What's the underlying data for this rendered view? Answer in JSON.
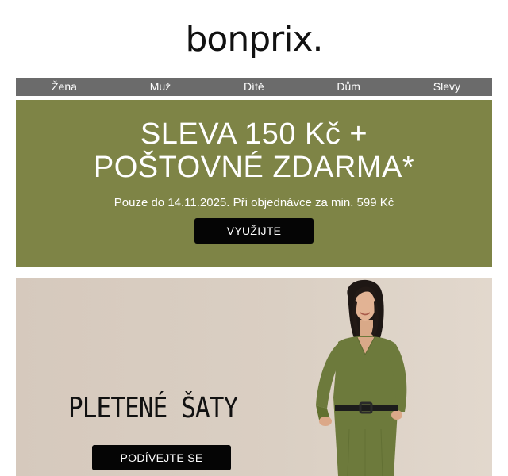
{
  "brand": {
    "logo_text": "bonprix."
  },
  "nav": {
    "items": [
      {
        "label": "Žena"
      },
      {
        "label": "Muž"
      },
      {
        "label": "Dítě"
      },
      {
        "label": "Dům"
      },
      {
        "label": "Slevy"
      }
    ]
  },
  "promo": {
    "title_line1": "SLEVA 150 Kč +",
    "title_line2": "POŠTOVNÉ ZDARMA*",
    "subtitle": "Pouze do 14.11.2025. Při objednávce za min. 599 Kč",
    "cta_label": "VYUŽIJTE",
    "background_color": "#7e8446"
  },
  "hero": {
    "title": "PLETENÉ ŠATY",
    "cta_label": "PODÍVEJTE SE",
    "image_subject": "woman-in-green-knit-dress"
  }
}
